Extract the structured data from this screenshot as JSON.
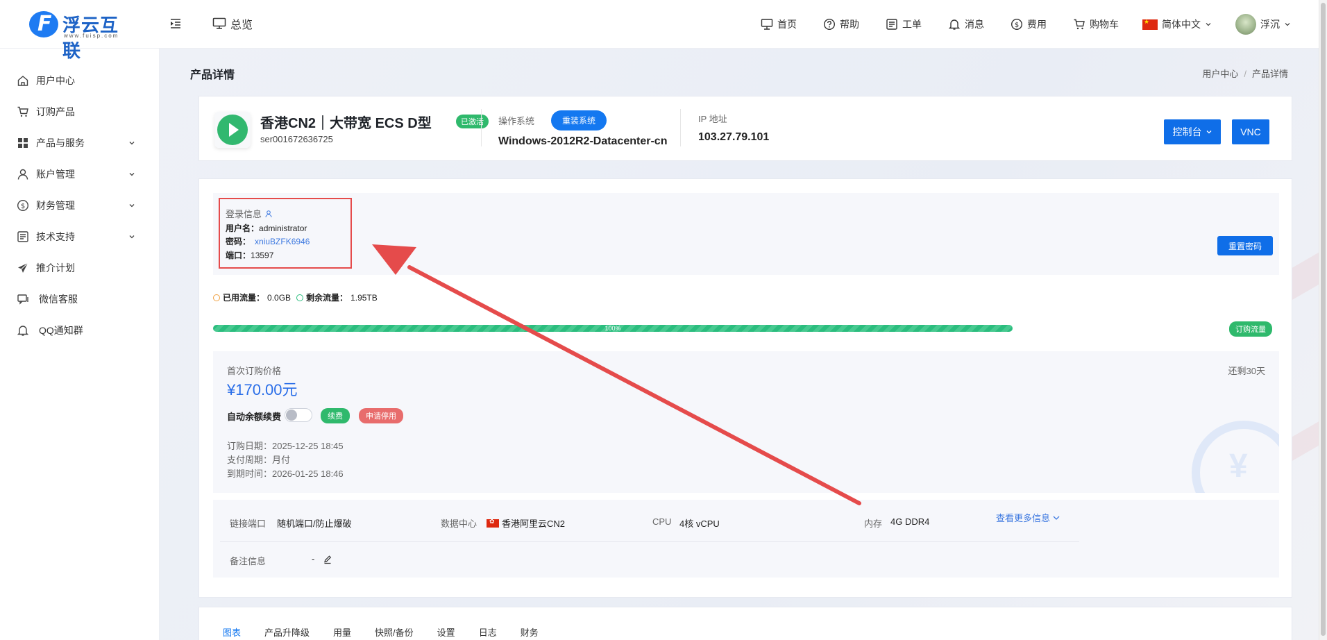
{
  "header": {
    "logo_text": "浮云互联",
    "logo_sub": "www.fuisp.com",
    "overview_label": "总览",
    "nav": [
      {
        "label": "首页",
        "icon": "monitor-icon"
      },
      {
        "label": "帮助",
        "icon": "help-icon"
      },
      {
        "label": "工单",
        "icon": "ticket-icon"
      },
      {
        "label": "消息",
        "icon": "bell-icon"
      },
      {
        "label": "费用",
        "icon": "dollar-icon"
      },
      {
        "label": "购物车",
        "icon": "cart-icon"
      }
    ],
    "language": "简体中文",
    "user_name": "浮沉"
  },
  "sidebar": {
    "items": [
      {
        "label": "用户中心",
        "icon": "home-icon",
        "expandable": false
      },
      {
        "label": "订购产品",
        "icon": "cart-icon",
        "expandable": false
      },
      {
        "label": "产品与服务",
        "icon": "grid-icon",
        "expandable": true
      },
      {
        "label": "账户管理",
        "icon": "user-icon",
        "expandable": true
      },
      {
        "label": "财务管理",
        "icon": "dollar-icon",
        "expandable": true
      },
      {
        "label": "技术支持",
        "icon": "ticket-icon",
        "expandable": true
      },
      {
        "label": "推介计划",
        "icon": "send-icon",
        "expandable": false
      },
      {
        "label": "微信客服",
        "icon": "chat-icon",
        "expandable": false
      },
      {
        "label": "QQ通知群",
        "icon": "bell-icon",
        "expandable": false
      }
    ]
  },
  "page": {
    "title": "产品详情",
    "breadcrumb": [
      "用户中心",
      "/",
      "产品详情"
    ]
  },
  "product": {
    "name": "香港CN2｜大带宽 ECS D型",
    "status": "已激活",
    "id": "ser001672636725",
    "os_label": "操作系统",
    "os_value": "Windows-2012R2-Datacenter-cn",
    "reinstall_label": "重装系统",
    "ip_label": "IP 地址",
    "ip_value": "103.27.79.101",
    "console_label": "控制台",
    "vnc_label": "VNC"
  },
  "login": {
    "title": "登录信息",
    "username_key": "用户名：",
    "username": "administrator",
    "password_key": "密码：",
    "password": "xniuBZFK6946",
    "port_key": "端口：",
    "port": "13597",
    "reset_label": "重置密码"
  },
  "traffic": {
    "used_label": "已用流量：",
    "used": "0.0GB",
    "remain_label": "剩余流量：",
    "remain": "1.95TB",
    "percent_text": "100%",
    "percent": 100,
    "buy_label": "订购流量"
  },
  "billing": {
    "first_price_label": "首次订购价格",
    "price": "¥170.00元",
    "remaining": "还剩30天",
    "auto_renew_label": "自动余额续费",
    "auto_renew_on": false,
    "renew_label": "续费",
    "stop_label": "申请停用",
    "order_date": "订购日期：2025-12-25 18:45",
    "cycle": "支付周期：月付",
    "expire": "到期时间：2026-01-25 18:46"
  },
  "specs": {
    "port_label": "链接端口",
    "port_value": "随机端口/防止爆破",
    "dc_label": "数据中心",
    "dc_value": "香港阿里云CN2",
    "cpu_label": "CPU",
    "cpu_value": "4核 vCPU",
    "mem_label": "内存",
    "mem_value": "4G DDR4",
    "more_label": "查看更多信息",
    "note_label": "备注信息",
    "note_value": "-"
  },
  "tabs": [
    "图表",
    "产品升降级",
    "用量",
    "快照/备份",
    "设置",
    "日志",
    "财务"
  ],
  "colors": {
    "primary": "#0f6ee8",
    "success": "#2fb96c",
    "danger": "#e86c6c",
    "annotation": "#e54b4b"
  }
}
